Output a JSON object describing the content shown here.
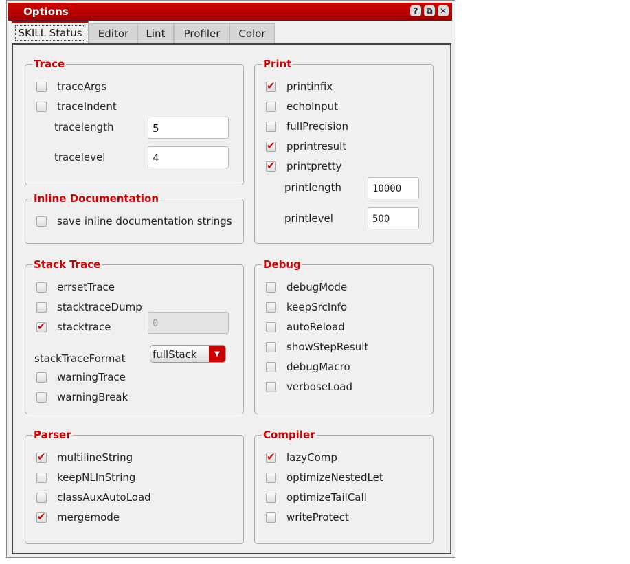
{
  "window": {
    "title": "Options",
    "buttons": [
      "?",
      "⧉",
      "✕"
    ]
  },
  "tabs": [
    "SKILL Status",
    "Editor",
    "Lint",
    "Profiler",
    "Color"
  ],
  "trace": {
    "title": "Trace",
    "checks": [
      {
        "label": "traceArgs",
        "checked": false
      },
      {
        "label": "traceIndent",
        "checked": false
      }
    ],
    "tracelength_label": "tracelength",
    "tracelength": "5",
    "tracelevel_label": "tracelevel",
    "tracelevel": "4"
  },
  "inline": {
    "title": "Inline Documentation",
    "checks": [
      {
        "label": "save inline documentation strings",
        "checked": false
      }
    ]
  },
  "print": {
    "title": "Print",
    "checks": [
      {
        "label": "printinfix",
        "checked": true
      },
      {
        "label": "echoInput",
        "checked": false
      },
      {
        "label": "fullPrecision",
        "checked": false
      },
      {
        "label": "pprintresult",
        "checked": true
      },
      {
        "label": "printpretty",
        "checked": true
      }
    ],
    "printlength_label": "printlength",
    "printlength": "10000",
    "printlevel_label": "printlevel",
    "printlevel": "500"
  },
  "stack": {
    "title": "Stack Trace",
    "checks": [
      {
        "label": "errsetTrace",
        "checked": false
      },
      {
        "label": "stacktraceDump",
        "checked": false
      },
      {
        "label": "stacktrace",
        "checked": true
      }
    ],
    "stacktrace_value": "0",
    "format_label": "stackTraceFormat",
    "format_value": "fullStack",
    "checks2": [
      {
        "label": "warningTrace",
        "checked": false
      },
      {
        "label": "warningBreak",
        "checked": false
      }
    ]
  },
  "debug": {
    "title": "Debug",
    "checks": [
      {
        "label": "debugMode",
        "checked": false
      },
      {
        "label": "keepSrcInfo",
        "checked": false
      },
      {
        "label": "autoReload",
        "checked": false
      },
      {
        "label": "showStepResult",
        "checked": false
      },
      {
        "label": "debugMacro",
        "checked": false
      },
      {
        "label": "verboseLoad",
        "checked": false
      }
    ]
  },
  "parser": {
    "title": "Parser",
    "checks": [
      {
        "label": "multilineString",
        "checked": true
      },
      {
        "label": "keepNLInString",
        "checked": false
      },
      {
        "label": "classAuxAutoLoad",
        "checked": false
      },
      {
        "label": "mergemode",
        "checked": true
      }
    ]
  },
  "compiler": {
    "title": "Compiler",
    "checks": [
      {
        "label": "lazyComp",
        "checked": true
      },
      {
        "label": "optimizeNestedLet",
        "checked": false
      },
      {
        "label": "optimizeTailCall",
        "checked": false
      },
      {
        "label": "writeProtect",
        "checked": false
      }
    ]
  }
}
